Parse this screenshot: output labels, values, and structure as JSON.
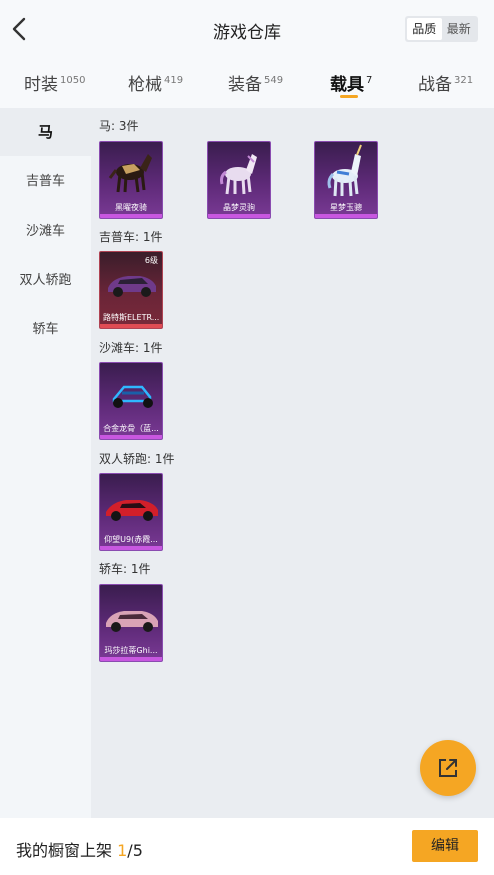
{
  "header": {
    "title": "游戏仓库",
    "sort_options": [
      "品质",
      "最新"
    ],
    "sort_selected": "品质"
  },
  "tabs": [
    {
      "label": "时装",
      "count": "1050"
    },
    {
      "label": "枪械",
      "count": "419"
    },
    {
      "label": "装备",
      "count": "549"
    },
    {
      "label": "载具",
      "count": "7"
    },
    {
      "label": "战备",
      "count": "321"
    }
  ],
  "active_tab": "载具",
  "sidebar": {
    "items": [
      {
        "label": "马"
      },
      {
        "label": "吉普车"
      },
      {
        "label": "沙滩车"
      },
      {
        "label": "双人轿跑"
      },
      {
        "label": "轿车"
      }
    ],
    "active": "马"
  },
  "sections": [
    {
      "label": "马: 3件",
      "items": [
        {
          "name": "黑曜夜骑",
          "icon": "dark-horse-icon"
        },
        {
          "name": "晶梦灵驹",
          "icon": "crystal-horse-icon"
        },
        {
          "name": "星梦玉骢",
          "icon": "unicorn-icon"
        }
      ]
    },
    {
      "label": "吉普车: 1件",
      "items": [
        {
          "name": "路特斯ELETR...",
          "level": "6级",
          "icon": "car-icon"
        }
      ]
    },
    {
      "label": "沙滩车: 1件",
      "items": [
        {
          "name": "合金龙骨（蓝...",
          "icon": "buggy-icon"
        }
      ]
    },
    {
      "label": "双人轿跑: 1件",
      "items": [
        {
          "name": "仰望U9(赤霞...",
          "icon": "sports-car-icon"
        }
      ]
    },
    {
      "label": "轿车: 1件",
      "items": [
        {
          "name": "玛莎拉蒂Ghi...",
          "icon": "sedan-icon"
        }
      ]
    }
  ],
  "bottom": {
    "shelf_label": "我的橱窗上架",
    "shelf_current": "1",
    "shelf_total": "/5",
    "edit_label": "编辑"
  },
  "colors": {
    "accent": "#f5a623",
    "card_purple": "#5e2a78",
    "card_red": "#6a2538"
  },
  "icons": {
    "back": "chevron-left-icon",
    "share": "share-external-icon"
  }
}
